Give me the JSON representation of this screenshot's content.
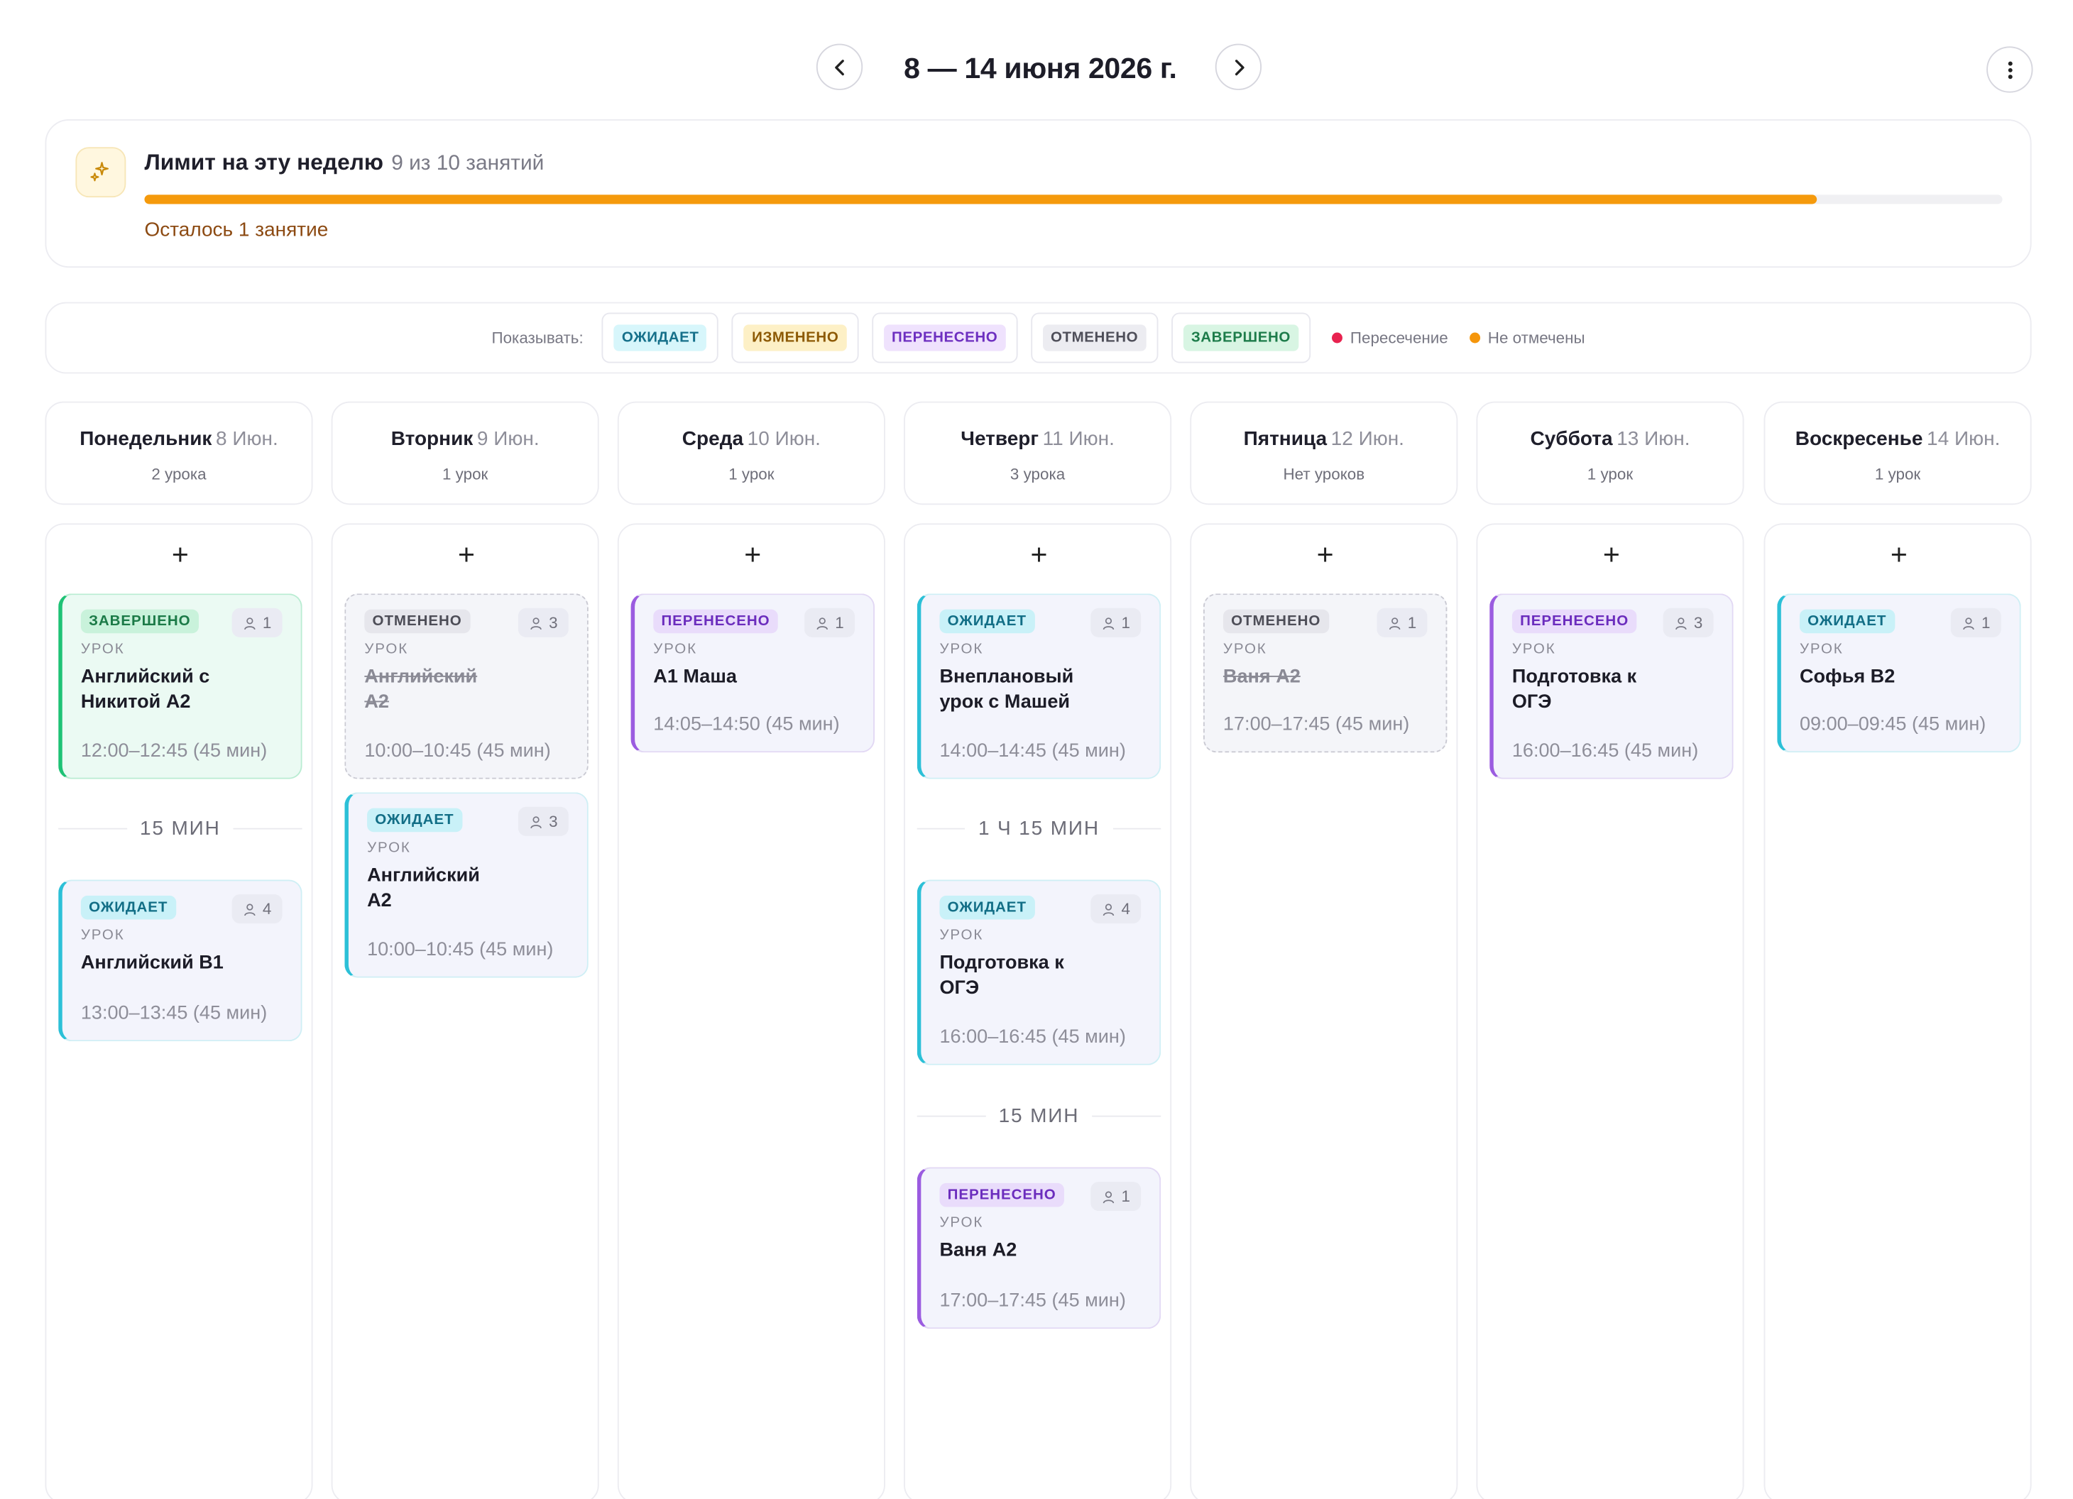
{
  "header": {
    "week_title": "8 — 14 июня 2026 г."
  },
  "limit": {
    "title": "Лимит на эту неделю",
    "count_text": "9 из 10 занятий",
    "used": 9,
    "total": 10,
    "progress_fraction": 0.9,
    "remaining_text": "Осталось 1 занятие"
  },
  "filters": {
    "label": "Показывать:",
    "chips": [
      "ОЖИДАЕТ",
      "ИЗМЕНЕНО",
      "ПЕРЕНЕСЕНО",
      "ОТМЕНЕНО",
      "ЗАВЕРШЕНО"
    ],
    "legend": [
      {
        "label": "Пересечение",
        "color": "#e8224f"
      },
      {
        "label": "Не отмечены",
        "color": "#f5960b"
      }
    ]
  },
  "colors": {
    "accent_progress": "#f59a0c",
    "status_done": "#1ec275",
    "status_wait": "#2cc0d7",
    "status_moved": "#9b5ce0",
    "status_cancel": "#9a9aa5"
  },
  "days": [
    {
      "name": "Понедельник",
      "date": "8 Июн.",
      "count": "2 урока",
      "add": "+",
      "cards": [
        {
          "status": "ЗАВЕРШЕНО",
          "people": "1",
          "kind": "УРОК",
          "title": "Английский с Никитой А2",
          "time": "12:00–12:45 (45 мин)"
        },
        {
          "status": "ОЖИДАЕТ",
          "people": "4",
          "kind": "УРОК",
          "title": "Английский B1",
          "time": "13:00–13:45 (45 мин)"
        }
      ],
      "gaps": [
        "15 МИН"
      ]
    },
    {
      "name": "Вторник",
      "date": "9 Июн.",
      "count": "1 урок",
      "add": "+",
      "cards": [
        {
          "status": "ОТМЕНЕНО",
          "people": "3",
          "kind": "УРОК",
          "title": "Английский А2",
          "time": "10:00–10:45 (45 мин)"
        },
        {
          "status": "ОЖИДАЕТ",
          "people": "3",
          "kind": "УРОК",
          "title": "Английский А2",
          "time": "10:00–10:45 (45 мин)"
        }
      ]
    },
    {
      "name": "Среда",
      "date": "10 Июн.",
      "count": "1 урок",
      "add": "+",
      "cards": [
        {
          "status": "ПЕРЕНЕСЕНО",
          "people": "1",
          "kind": "УРОК",
          "title": "А1 Маша",
          "time": "14:05–14:50 (45 мин)"
        }
      ]
    },
    {
      "name": "Четверг",
      "date": "11 Июн.",
      "count": "3 урока",
      "add": "+",
      "cards": [
        {
          "status": "ОЖИДАЕТ",
          "people": "1",
          "kind": "УРОК",
          "title": "Внеплановый урок с Машей",
          "time": "14:00–14:45 (45 мин)"
        },
        {
          "status": "ОЖИДАЕТ",
          "people": "4",
          "kind": "УРОК",
          "title": "Подготовка к ОГЭ",
          "time": "16:00–16:45 (45 мин)"
        },
        {
          "status": "ПЕРЕНЕСЕНО",
          "people": "1",
          "kind": "УРОК",
          "title": "Ваня А2",
          "time": "17:00–17:45 (45 мин)"
        }
      ],
      "gaps": [
        "1 Ч 15 МИН",
        "15 МИН"
      ]
    },
    {
      "name": "Пятница",
      "date": "12 Июн.",
      "count": "Нет уроков",
      "add": "+",
      "cards": [
        {
          "status": "ОТМЕНЕНО",
          "people": "1",
          "kind": "УРОК",
          "title": "Ваня А2",
          "time": "17:00–17:45 (45 мин)"
        }
      ]
    },
    {
      "name": "Суббота",
      "date": "13 Июн.",
      "count": "1 урок",
      "add": "+",
      "cards": [
        {
          "status": "ПЕРЕНЕСЕНО",
          "people": "3",
          "kind": "УРОК",
          "title": "Подготовка к ОГЭ",
          "time": "16:00–16:45 (45 мин)"
        }
      ]
    },
    {
      "name": "Воскресенье",
      "date": "14 Июн.",
      "count": "1 урок",
      "add": "+",
      "cards": [
        {
          "status": "ОЖИДАЕТ",
          "people": "1",
          "kind": "УРОК",
          "title": "Софья B2",
          "time": "09:00–09:45 (45 мин)"
        }
      ]
    }
  ]
}
